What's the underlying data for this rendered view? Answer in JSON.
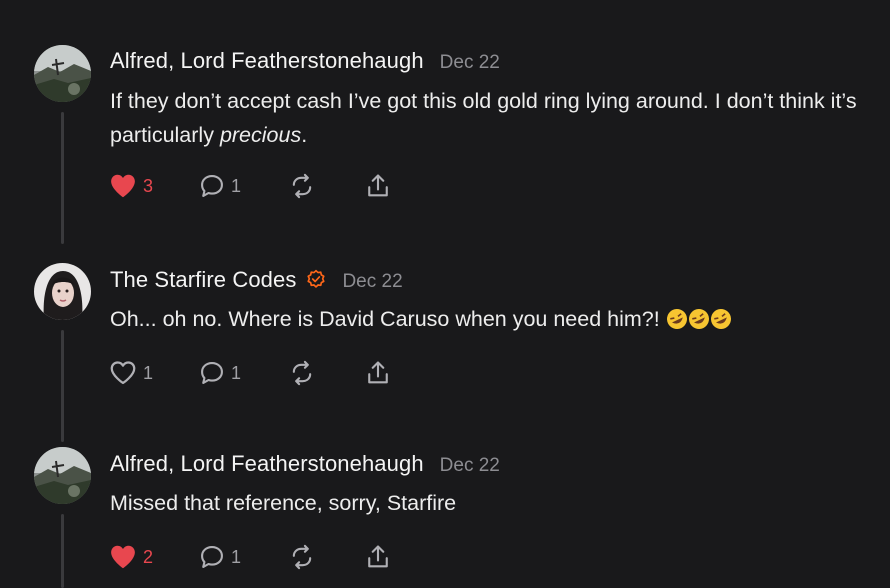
{
  "comments": [
    {
      "author": "Alfred, Lord Featherstonehaugh",
      "date": "Dec 22",
      "text_before": "If they don’t accept cash I’ve got this old gold ring lying around. I don’t think it’s particularly ",
      "text_em": "precious",
      "text_after": ".",
      "likes": "3",
      "liked": true,
      "replies": "1",
      "avatar_icon": "landscape-avatar"
    },
    {
      "author": "The Starfire Codes",
      "date": "Dec 22",
      "verified_icon": "verified-badge-icon",
      "text": "Oh... oh no. Where is David Caruso when you need him?!",
      "emoji": [
        "rolling-on-floor-laughing-emoji",
        "rolling-on-floor-laughing-emoji",
        "rolling-on-floor-laughing-emoji"
      ],
      "likes": "1",
      "liked": false,
      "replies": "1",
      "avatar_icon": "portrait-avatar"
    },
    {
      "author": "Alfred, Lord Featherstonehaugh",
      "date": "Dec 22",
      "text": "Missed that reference, sorry, Starfire",
      "likes": "2",
      "liked": true,
      "replies": "1",
      "avatar_icon": "landscape-avatar"
    }
  ],
  "colors": {
    "background": "#19191b",
    "liked_heart": "#e8474f",
    "accent_orange": "#ff6719",
    "muted": "#8d8d92"
  }
}
